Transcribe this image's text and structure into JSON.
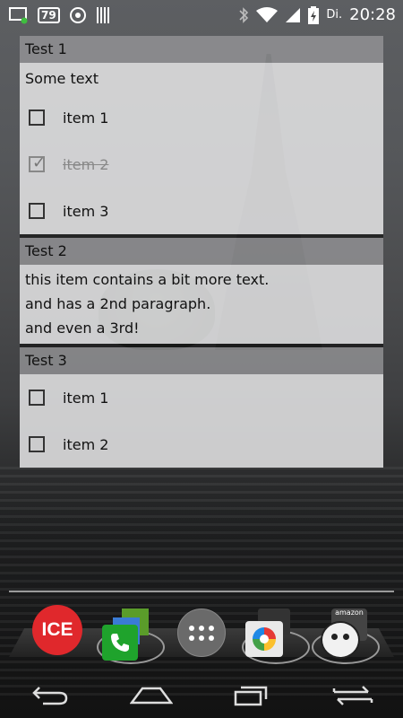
{
  "status_bar": {
    "icons_left": [
      "notification-app-icon",
      "badge-79-icon",
      "sync-circle-icon",
      "barcode-icon"
    ],
    "badge_number": "79",
    "icons_right": [
      "bluetooth-icon",
      "wifi-icon",
      "signal-icon",
      "battery-charging-icon"
    ],
    "day": "Di.",
    "time": "20:28"
  },
  "lists": [
    {
      "title": "Test 1",
      "text": "Some text",
      "items": [
        {
          "label": "item 1",
          "checked": false
        },
        {
          "label": "item 2",
          "checked": true
        },
        {
          "label": "item 3",
          "checked": false
        }
      ]
    },
    {
      "title": "Test 2",
      "paragraphs": [
        "this item contains a bit more text.",
        "and has a 2nd paragraph.",
        "and even a 3rd!"
      ]
    },
    {
      "title": "Test 3",
      "items": [
        {
          "label": "item 1",
          "checked": false
        },
        {
          "label": "item 2",
          "checked": false
        }
      ]
    }
  ],
  "dock": {
    "ice_label": "ICE",
    "market_label": "amazon",
    "icons": [
      "ice-app-icon",
      "phone-folder-icon",
      "app-drawer-icon",
      "camera-photos-folder-icon",
      "market-folder-icon"
    ]
  },
  "nav_bar": {
    "buttons": [
      "back-icon",
      "home-icon",
      "recents-icon",
      "switch-icon"
    ]
  },
  "colors": {
    "header_bg": "#969698",
    "body_bg": "#e1e1e3",
    "ice_red": "#e0282c",
    "phone_green": "#1fa32c"
  }
}
